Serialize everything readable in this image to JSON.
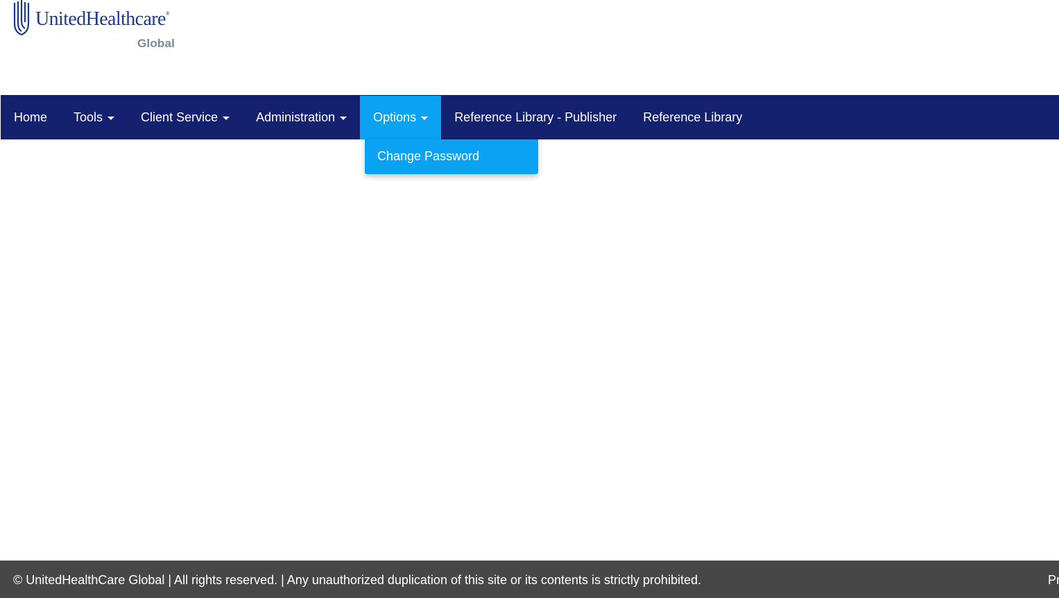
{
  "logo": {
    "brand": "UnitedHealthcare",
    "registered_mark": "®",
    "subtitle": "Global",
    "icon": "uhc-shield-icon",
    "brand_color": "#1a3a8c"
  },
  "navbar": {
    "background_color": "#14216f",
    "active_color": "#0aa2f3",
    "items": [
      {
        "label": "Home",
        "has_dropdown": false
      },
      {
        "label": "Tools",
        "has_dropdown": true
      },
      {
        "label": "Client Service",
        "has_dropdown": true
      },
      {
        "label": "Administration",
        "has_dropdown": true
      },
      {
        "label": "Options",
        "has_dropdown": true,
        "active": true
      },
      {
        "label": "Reference Library - Publisher",
        "has_dropdown": false
      },
      {
        "label": "Reference Library",
        "has_dropdown": false
      }
    ]
  },
  "dropdown": {
    "parent": "Options",
    "items": [
      {
        "label": "Change Password"
      }
    ]
  },
  "footer": {
    "background_color": "#474747",
    "text": "© UnitedHealthCare Global | All rights reserved. | Any unauthorized duplication of this site or its contents is strictly prohibited.",
    "right_text": "Pr"
  }
}
